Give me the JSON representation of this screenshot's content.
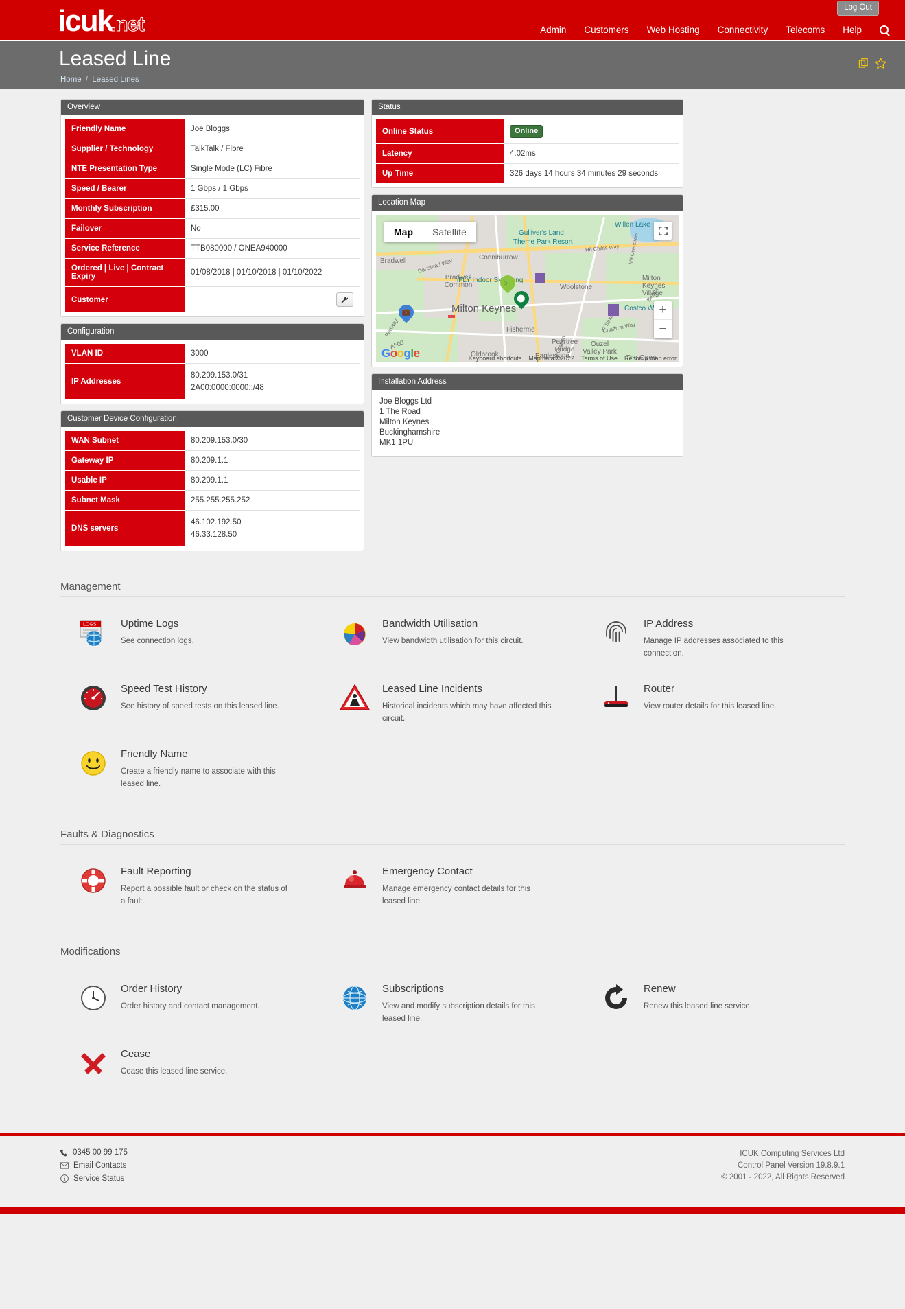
{
  "brand": {
    "name": "icuk",
    "suffix": ".net",
    "color": "#d10000"
  },
  "topbar": {
    "logout_label": "Log Out",
    "nav": [
      {
        "label": "Admin"
      },
      {
        "label": "Customers"
      },
      {
        "label": "Web Hosting"
      },
      {
        "label": "Connectivity"
      },
      {
        "label": "Telecoms"
      },
      {
        "label": "Help"
      }
    ]
  },
  "pagehead": {
    "title": "Leased Line",
    "breadcrumb_home": "Home",
    "breadcrumb_sep": "/",
    "breadcrumb_current": "Leased Lines"
  },
  "overview": {
    "title": "Overview",
    "rows": [
      {
        "key": "Friendly Name",
        "value": "Joe Bloggs"
      },
      {
        "key": "Supplier / Technology",
        "value": "TalkTalk / Fibre"
      },
      {
        "key": "NTE Presentation Type",
        "value": "Single Mode (LC) Fibre"
      },
      {
        "key": "Speed / Bearer",
        "value": "1 Gbps / 1 Gbps"
      },
      {
        "key": "Monthly Subscription",
        "value": "£315.00"
      },
      {
        "key": "Failover",
        "value": "No"
      },
      {
        "key": "Service Reference",
        "value": "TTB080000 / ONEA940000"
      },
      {
        "key": "Ordered | Live | Contract Expiry",
        "value": "01/08/2018 | 01/10/2018 | 01/10/2022"
      },
      {
        "key": "Customer",
        "value": ""
      }
    ]
  },
  "configuration": {
    "title": "Configuration",
    "vlan_key": "VLAN ID",
    "vlan_value": "3000",
    "ip_key": "IP Addresses",
    "ip_value_1": "80.209.153.0/31",
    "ip_value_2": "2A00:0000:0000::/48"
  },
  "device_config": {
    "title": "Customer Device Configuration",
    "rows": [
      {
        "key": "WAN Subnet",
        "value": "80.209.153.0/30"
      },
      {
        "key": "Gateway IP",
        "value": "80.209.1.1"
      },
      {
        "key": "Usable IP",
        "value": "80.209.1.1"
      },
      {
        "key": "Subnet Mask",
        "value": "255.255.255.252"
      }
    ],
    "dns_key": "DNS servers",
    "dns_value_1": "46.102.192.50",
    "dns_value_2": "46.33.128.50"
  },
  "status": {
    "title": "Status",
    "online_key": "Online Status",
    "online_value": "Online",
    "online_color": "#3c763d",
    "latency_key": "Latency",
    "latency_value": "4.02ms",
    "uptime_key": "Up Time",
    "uptime_value": "326 days 14 hours 34 minutes 29 seconds"
  },
  "map": {
    "title": "Location Map",
    "type_map": "Map",
    "type_satellite": "Satellite",
    "zoom_in": "+",
    "zoom_out": "−",
    "logo_text": "Google",
    "attrib_shortcuts": "Keyboard shortcuts",
    "attrib_mapdata": "Map data ©2022",
    "attrib_terms": "Terms of Use",
    "attrib_report": "Report a map error",
    "labels": [
      {
        "text": "Gulliver's Land",
        "teal": true
      },
      {
        "text": "Theme Park Resort",
        "teal": true
      },
      {
        "text": "Willen Lake",
        "teal": true
      },
      {
        "text": "Conniburrow"
      },
      {
        "text": "Bradwell"
      },
      {
        "text": "Bradwell Common"
      },
      {
        "text": "iFLY Indoor Skydiving",
        "teal": true
      },
      {
        "text": "Milton Keynes",
        "big": true
      },
      {
        "text": "Milton Keynes Village"
      },
      {
        "text": "Woolstone"
      },
      {
        "text": "Costco Wholes",
        "teal": true
      },
      {
        "text": "Fisherme"
      },
      {
        "text": "Peartree Bridge"
      },
      {
        "text": "Ouzel Valley Park"
      },
      {
        "text": "Oldbrook"
      },
      {
        "text": "Eaglestone"
      },
      {
        "text": "The Open"
      },
      {
        "text": "Danstead Way"
      },
      {
        "text": "A509"
      },
      {
        "text": "Portway"
      },
      {
        "text": "V6 Grafton"
      },
      {
        "text": "V7 Saxon St"
      },
      {
        "text": "B4034"
      },
      {
        "text": "H6 Childs Way"
      },
      {
        "text": "V9 Overstreet"
      },
      {
        "text": "Chaffron Way"
      }
    ]
  },
  "install_address": {
    "title": "Installation Address",
    "lines": [
      "Joe Bloggs Ltd",
      "1 The Road",
      "Milton Keynes",
      "Buckinghamshire",
      "MK1 1PU"
    ]
  },
  "management": {
    "title": "Management",
    "tiles": [
      {
        "icon": "logs-globe-icon",
        "title": "Uptime Logs",
        "desc": "See connection logs."
      },
      {
        "icon": "pie-chart-icon",
        "title": "Bandwidth Utilisation",
        "desc": "View bandwidth utilisation for this circuit."
      },
      {
        "icon": "fingerprint-icon",
        "title": "IP Address",
        "desc": "Manage IP addresses associated to this connection."
      },
      {
        "icon": "speedometer-icon",
        "title": "Speed Test History",
        "desc": "See history of speed tests on this leased line."
      },
      {
        "icon": "roadworks-warning-icon",
        "title": "Leased Line Incidents",
        "desc": "Historical incidents which may have affected this circuit."
      },
      {
        "icon": "router-icon",
        "title": "Router",
        "desc": "View router details for this leased line."
      },
      {
        "icon": "smiley-face-icon",
        "title": "Friendly Name",
        "desc": "Create a friendly name to associate with this leased line."
      }
    ]
  },
  "faults": {
    "title": "Faults & Diagnostics",
    "tiles": [
      {
        "icon": "lifebuoy-icon",
        "title": "Fault Reporting",
        "desc": "Report a possible fault or check on the status of a fault."
      },
      {
        "icon": "alarm-bell-icon",
        "title": "Emergency Contact",
        "desc": "Manage emergency contact details for this leased line."
      }
    ]
  },
  "modifications": {
    "title": "Modifications",
    "tiles": [
      {
        "icon": "clock-icon",
        "title": "Order History",
        "desc": "Order history and contact management."
      },
      {
        "icon": "globe-icon",
        "title": "Subscriptions",
        "desc": "View and modify subscription details for this leased line."
      },
      {
        "icon": "renew-arrow-icon",
        "title": "Renew",
        "desc": "Renew this leased line service."
      },
      {
        "icon": "red-cross-icon",
        "title": "Cease",
        "desc": "Cease this leased line service."
      }
    ]
  },
  "footer": {
    "phone": "0345 00 99 175",
    "email_contacts": "Email Contacts",
    "service_status": "Service Status",
    "company": "ICUK Computing Services Ltd",
    "version": "Control Panel Version 19.8.9.1",
    "copyright": "© 2001 - 2022, All Rights Reserved"
  }
}
